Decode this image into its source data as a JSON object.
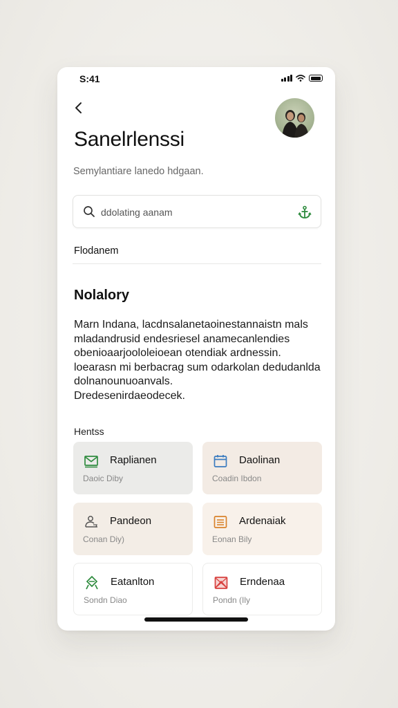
{
  "status": {
    "time": "S:41"
  },
  "header": {
    "title": "Sanelrlenssi",
    "subtitle": "Semylantiare lanedo hdgaan."
  },
  "search": {
    "placeholder": "ddolating aanam"
  },
  "section_link": "Flodanem",
  "content": {
    "heading": "Nolalory",
    "lines": [
      "Marn Indana, lacdnsalanetaoinestannaistn mals",
      "mladandrusid endesriesel anamecanlendies",
      "obenioaarjoololeioean otendiak ardnessin.",
      "loearasn mi berbacrag sum odarkolan dedudanlda",
      "dolnanounuoanvals.",
      "Dredesenirdaeodecek."
    ]
  },
  "items": {
    "label": "Hentss",
    "cards": [
      {
        "title": "Raplianen",
        "sub": "Daoic Diby",
        "icon": "mail-icon",
        "accent": "#2e8b3e",
        "bg": "#ebebe9"
      },
      {
        "title": "Daolinan",
        "sub": "Coadin Ibdon",
        "icon": "calendar-icon",
        "accent": "#3a7bbf",
        "bg": "#f3ebe4"
      },
      {
        "title": "Pandeon",
        "sub": "Conan Diy)",
        "icon": "chef-icon",
        "accent": "#555555",
        "bg": "#f3ede6"
      },
      {
        "title": "Ardenaiak",
        "sub": "Eonan Bily",
        "icon": "list-icon",
        "accent": "#d9822b",
        "bg": "#f8f1ea"
      },
      {
        "title": "Eatanlton",
        "sub": "Sondn Diao",
        "icon": "recycle-icon",
        "accent": "#2e8b3e",
        "bg": "#ffffff"
      },
      {
        "title": "Erndenaa",
        "sub": "Pondn (Ily",
        "icon": "image-icon",
        "accent": "#d8413f",
        "bg": "#ffffff"
      }
    ]
  }
}
